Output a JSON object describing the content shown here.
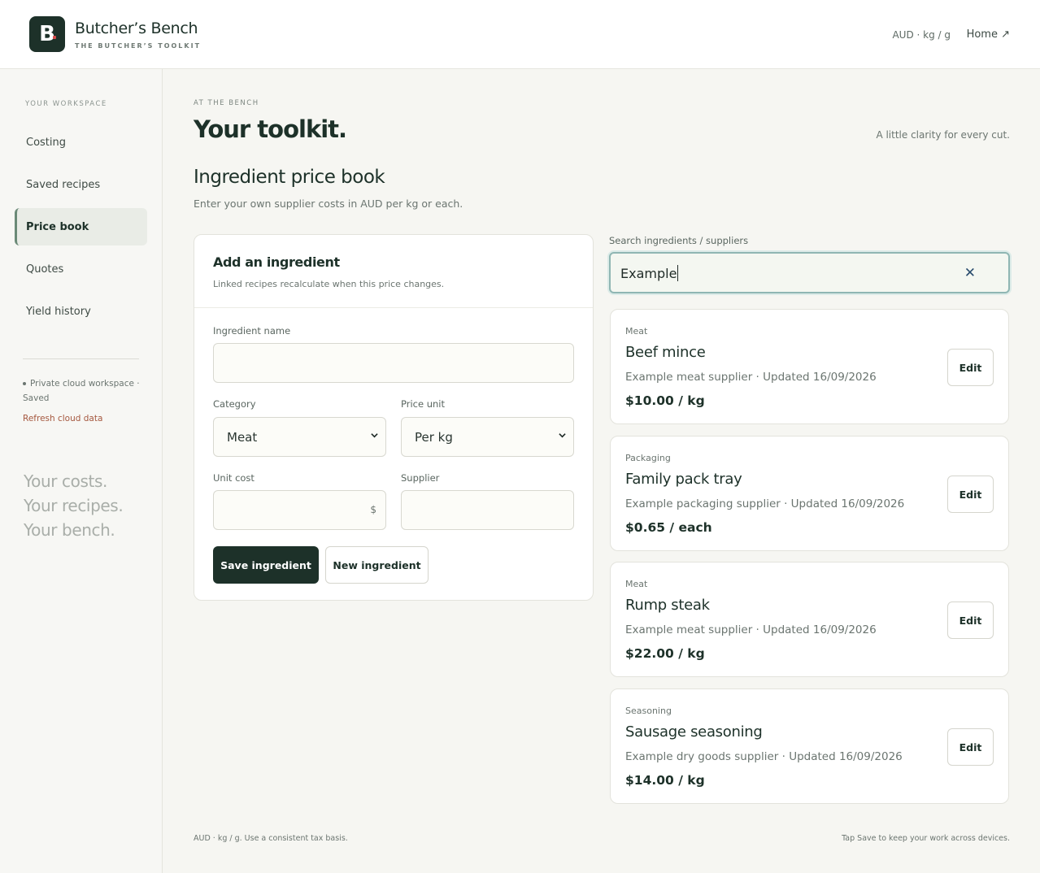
{
  "brand": {
    "mark": "B",
    "name": "Butcher’s Bench",
    "tagline": "THE BUTCHER’S TOOLKIT"
  },
  "header": {
    "units": "AUD · kg / g",
    "home_label": "Home ↗"
  },
  "sidebar": {
    "heading": "YOUR WORKSPACE",
    "items": [
      {
        "label": "Costing",
        "active": false
      },
      {
        "label": "Saved recipes",
        "active": false
      },
      {
        "label": "Price book",
        "active": true
      },
      {
        "label": "Quotes",
        "active": false
      },
      {
        "label": "Yield history",
        "active": false
      }
    ],
    "status": "Private cloud workspace · Saved",
    "refresh_label": "Refresh cloud data",
    "tagline": [
      "Your costs.",
      "Your recipes.",
      "Your bench."
    ]
  },
  "page": {
    "eyebrow": "AT THE BENCH",
    "title": "Your toolkit.",
    "aside": "A little clarity for every cut.",
    "section_title": "Ingredient price book",
    "section_sub": "Enter your own supplier costs in AUD per kg or each."
  },
  "form": {
    "title": "Add an ingredient",
    "subtitle": "Linked recipes recalculate when this price changes.",
    "name_label": "Ingredient name",
    "name_value": "",
    "category_label": "Category",
    "category_value": "Meat",
    "unit_label": "Price unit",
    "unit_value": "Per kg",
    "cost_label": "Unit cost",
    "cost_symbol": "$",
    "supplier_label": "Supplier",
    "supplier_value": "",
    "save_label": "Save ingredient",
    "new_label": "New ingredient"
  },
  "search": {
    "label": "Search ingredients / suppliers",
    "value": "Example",
    "clear_icon": "✕"
  },
  "results": [
    {
      "category": "Meat",
      "name": "Beef mince",
      "meta": "Example meat supplier · Updated 16/09/2026",
      "price": "$10.00 / kg",
      "edit_label": "Edit"
    },
    {
      "category": "Packaging",
      "name": "Family pack tray",
      "meta": "Example packaging supplier · Updated 16/09/2026",
      "price": "$0.65 / each",
      "edit_label": "Edit"
    },
    {
      "category": "Meat",
      "name": "Rump steak",
      "meta": "Example meat supplier · Updated 16/09/2026",
      "price": "$22.00 / kg",
      "edit_label": "Edit"
    },
    {
      "category": "Seasoning",
      "name": "Sausage seasoning",
      "meta": "Example dry goods supplier · Updated 16/09/2026",
      "price": "$14.00 / kg",
      "edit_label": "Edit"
    }
  ],
  "footer": {
    "left": "AUD · kg / g. Use a consistent tax basis.",
    "right": "Tap Save to keep your work across devices."
  },
  "colors": {
    "brand_dark": "#1d3129",
    "accent_red": "#d64a4a",
    "focus_ring": "#8fb6b3",
    "link_rust": "#a5583f"
  }
}
